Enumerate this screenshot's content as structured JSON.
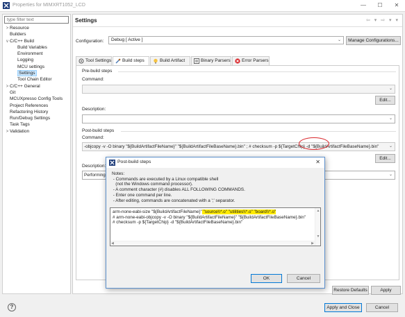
{
  "window": {
    "title": "Properties for MIMXRT1052_LCD",
    "controls": [
      "—",
      "☐",
      "✕"
    ]
  },
  "sidebar": {
    "filter_placeholder": "type filter text",
    "items": [
      {
        "label": "Resource",
        "twisty": ">"
      },
      {
        "label": "Builders",
        "twisty": ""
      },
      {
        "label": "C/C++ Build",
        "twisty": "v"
      },
      {
        "label": "Build Variables",
        "twisty": ""
      },
      {
        "label": "Environment",
        "twisty": ""
      },
      {
        "label": "Logging",
        "twisty": ""
      },
      {
        "label": "MCU settings",
        "twisty": ""
      },
      {
        "label": "Settings",
        "twisty": ""
      },
      {
        "label": "Tool Chain Editor",
        "twisty": ""
      },
      {
        "label": "C/C++ General",
        "twisty": ">"
      },
      {
        "label": "Git",
        "twisty": ""
      },
      {
        "label": "MCUXpresso Config Tools",
        "twisty": ""
      },
      {
        "label": "Project References",
        "twisty": ""
      },
      {
        "label": "Refactoring History",
        "twisty": ""
      },
      {
        "label": "Run/Debug Settings",
        "twisty": ""
      },
      {
        "label": "Task Tags",
        "twisty": ""
      },
      {
        "label": "Validation",
        "twisty": ">"
      }
    ]
  },
  "main": {
    "title": "Settings",
    "nav_arrows": "⇦ ▾ ⇨ ▾ ▾",
    "configuration_label": "Configuration:",
    "configuration_value": "Debug [ Active ]",
    "manage_button": "Manage Configurations...",
    "tabs": [
      "Tool Settings",
      "Build steps",
      "Build Artifact",
      "Binary Parsers",
      "Error Parsers"
    ],
    "prebuild": {
      "heading": "Pre-build steps",
      "command_label": "Command:",
      "command_value": "",
      "edit_button": "Edit...",
      "description_label": "Description:",
      "description_value": ""
    },
    "postbuild": {
      "heading": "Post-build steps",
      "command_label": "Command:",
      "command_value": "-objcopy -v -O binary \"${BuildArtifactFileName}\" \"${BuildArtifactFileBaseName}.bin\" ; # checksum -p ${TargetChip} -d \"${BuildArtifactFileBaseName}.bin\"",
      "edit_button": "Edit...",
      "description_label": "Description:",
      "description_value": "Performing"
    },
    "restore_button": "Restore Defaults",
    "apply_button": "Apply"
  },
  "footer": {
    "help_glyph": "?",
    "apply_close_button": "Apply and Close",
    "cancel_button": "Cancel"
  },
  "dialog": {
    "title": "Post-build steps",
    "close_glyph": "✕",
    "notes": [
      "Notes:",
      " - Commands are executed by a Linux compatible shell",
      "   (not the Windows command processor).",
      " - A comment character (#) disables ALL FOLLOWING COMMANDS.",
      " - Enter one command per line.",
      " - After editing, commands are concatenated with a ';' separator."
    ],
    "editor": {
      "line1_prefix": "arm-none-eabi-size \"${BuildArtifactFileName}\"",
      "line1_highlight": " \"source\\\\*.o\" \"utilities\\\\*.o\" \"board\\\\*.o\"",
      "line2": "# arm-none-eabi-objcopy -v -O binary \"${BuildArtifactFileName}\" \"${BuildArtifactFileBaseName}.bin\"",
      "line3": "# checksum -p ${TargetChip} -d \"${BuildArtifactFileBaseName}.bin\""
    },
    "ok_button": "OK",
    "cancel_button": "Cancel"
  },
  "colors": {
    "accent": "#0078d7",
    "highlight": "#ffeb00",
    "annotation": "#d9252a",
    "selection": "#cce8ff"
  }
}
